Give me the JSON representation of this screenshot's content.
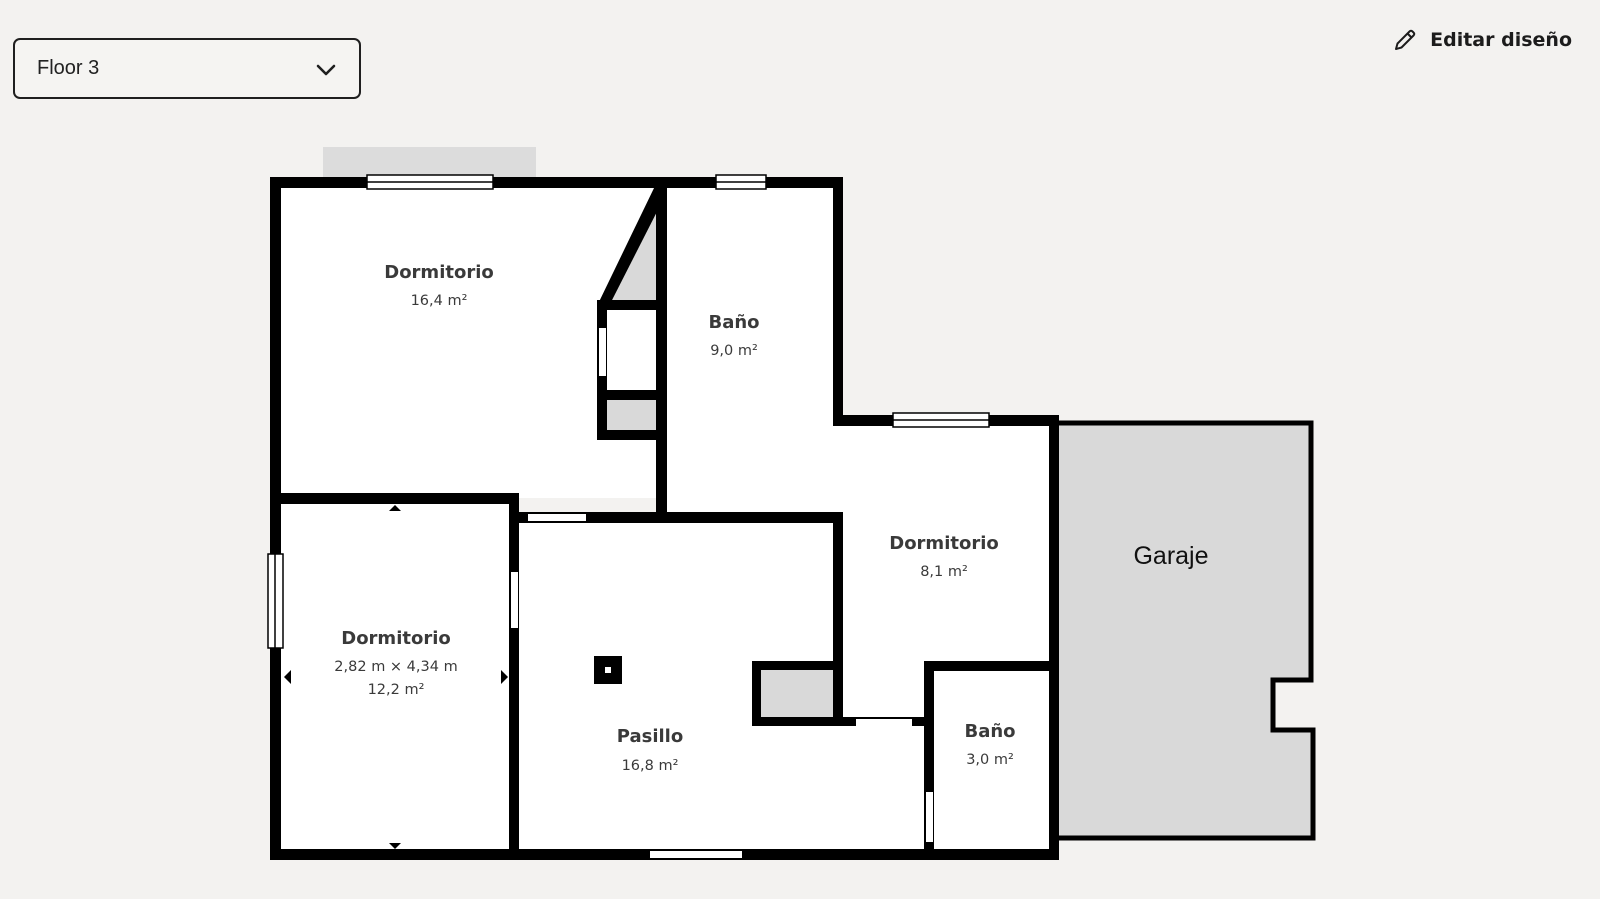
{
  "floor_selector": {
    "value": "Floor 3"
  },
  "edit_button": {
    "label": "Editar diseño"
  },
  "rooms": {
    "bedroom_main": {
      "name": "Dormitorio",
      "area": "16,4 m²"
    },
    "bathroom_main": {
      "name": "Baño",
      "area": "9,0 m²"
    },
    "bedroom_left": {
      "name": "Dormitorio",
      "dimensions": "2,82 m × 4,34 m",
      "area": "12,2 m²"
    },
    "hallway": {
      "name": "Pasillo",
      "area": "16,8 m²"
    },
    "bedroom_small": {
      "name": "Dormitorio",
      "area": "8,1 m²"
    },
    "bathroom_small": {
      "name": "Baño",
      "area": "3,0 m²"
    },
    "garage": {
      "name": "Garaje"
    }
  },
  "colors": {
    "background": "#f3f2f0",
    "wall": "#000000",
    "room_fill": "#ffffff",
    "shaded_fill": "#d9d9d9"
  },
  "icons": {
    "dropdown": "chevron-down-icon",
    "edit": "pencil-icon"
  }
}
